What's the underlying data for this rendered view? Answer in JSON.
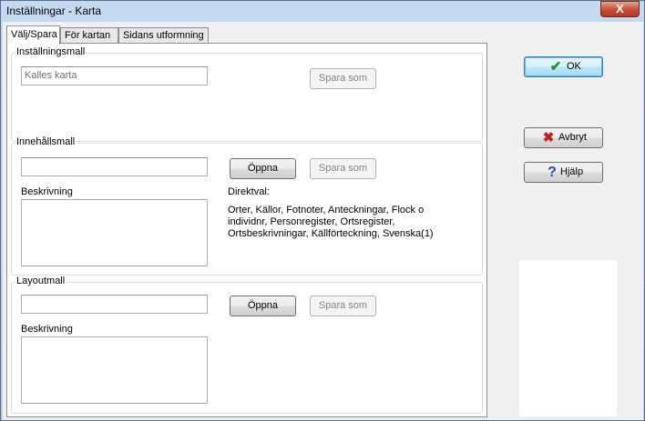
{
  "window": {
    "title": "Inställningar - Karta",
    "close_glyph": "X"
  },
  "tabs": [
    {
      "label": "Välj/Spara",
      "active": true
    },
    {
      "label": "För kartan",
      "active": false
    },
    {
      "label": "Sidans utformning",
      "active": false
    }
  ],
  "settings_template": {
    "group_label": "Inställningsmall",
    "input_value": "Kalles karta",
    "save_as_label": "Spara som"
  },
  "content_template": {
    "group_label": "Innehållsmall",
    "input_value": "",
    "open_label": "Öppna",
    "save_as_label": "Spara som",
    "description_label": "Beskrivning",
    "direct_choice_label": "Direktval:",
    "direct_choice_lines": [
      "Orter, Källor, Fotnoter, Anteckningar, Flock o",
      "individnr, Personregister, Ortsregister,",
      "Ortsbeskrivningar, Källförteckning, Svenska(1)"
    ]
  },
  "layout_template": {
    "group_label": "Layoutmall",
    "input_value": "",
    "open_label": "Öppna",
    "save_as_label": "Spara som",
    "description_label": "Beskrivning"
  },
  "buttons": {
    "ok_label": "OK",
    "cancel_label": "Avbryt",
    "help_label": "Hjälp"
  },
  "colors": {
    "ok_icon": "#1a9a1a",
    "cancel_icon": "#c0201a",
    "help_icon": "#1d4fb8"
  }
}
